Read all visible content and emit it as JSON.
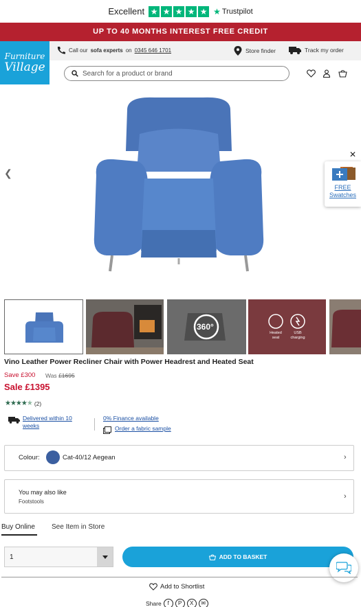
{
  "trustpilot": {
    "rating_word": "Excellent",
    "brand": "Trustpilot",
    "color": "#00b67a"
  },
  "promo": {
    "text": "UP TO 40 MONTHS INTEREST FREE CREDIT",
    "color": "#b5212f"
  },
  "logo": {
    "line1": "Furniture",
    "line2": "Village",
    "color": "#1aa2d9"
  },
  "header": {
    "call_prefix": "Call our",
    "call_bold": "sofa experts",
    "call_on": "on",
    "phone": "0345 646 1701",
    "store_finder": "Store finder",
    "track_order": "Track my order"
  },
  "search": {
    "placeholder": "Search for a product or brand",
    "value": ""
  },
  "gallery": {
    "swatch_line1": "FREE",
    "swatch_line2": "Swatches",
    "thumb_360": "360°",
    "thumb_heated": "Heated seat",
    "thumb_usb": "USB charging"
  },
  "product": {
    "title": "Vino Leather Power Recliner Chair with Power Headrest and Heated Seat",
    "save": "Save £300",
    "was_label": "Was",
    "was_price": "£1695",
    "sale_label": "Sale",
    "sale_price": "£1395",
    "rating": 4.5,
    "review_count": "(2)"
  },
  "info": {
    "delivery_line1": "Delivered within 10",
    "delivery_line2": "weeks",
    "finance": "0% Finance available",
    "fabric_sample": "Order a fabric sample"
  },
  "colour": {
    "label": "Colour:",
    "value": "Cat-40/12 Aegean",
    "swatch": "#3b5fa0"
  },
  "ymal": {
    "title": "You may also like",
    "sub": "Footstools"
  },
  "tabs": {
    "active": "Buy Online",
    "inactive": "See Item in Store"
  },
  "purchase": {
    "quantity": "1",
    "button": "ADD TO BASKET",
    "accent": "#1aa2d9"
  },
  "footer": {
    "shortlist": "Add to Shortlist",
    "share": "Share"
  }
}
